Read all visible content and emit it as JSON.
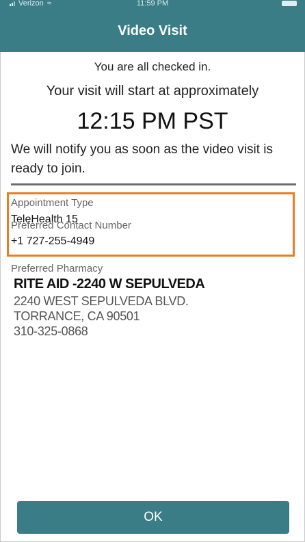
{
  "status_bar": {
    "carrier": "Verizon",
    "time": "11:59 PM"
  },
  "header": {
    "title": "Video Visit"
  },
  "checkin": {
    "message": "You are all checked in.",
    "start_text": "Your visit will start at approximately",
    "start_time": "12:15 PM PST",
    "notify_text": "We will notify you as soon as the video visit is ready to join."
  },
  "details": {
    "appointment_type_label": "Appointment Type",
    "appointment_type_value": "TeleHealth 15",
    "contact_label": "Preferred Contact Number",
    "contact_value": "+1 727-255-4949",
    "pharmacy_label": "Preferred Pharmacy",
    "pharmacy_name": "RITE AID -2240 W SEPULVEDA",
    "pharmacy_address1": "2240 WEST SEPULVEDA BLVD.",
    "pharmacy_address2": "TORRANCE, CA 90501",
    "pharmacy_phone": "310-325-0868"
  },
  "actions": {
    "ok_label": "OK"
  },
  "colors": {
    "header": "#3b7d87",
    "highlight": "#ea7d22",
    "button": "#3b7d87"
  }
}
